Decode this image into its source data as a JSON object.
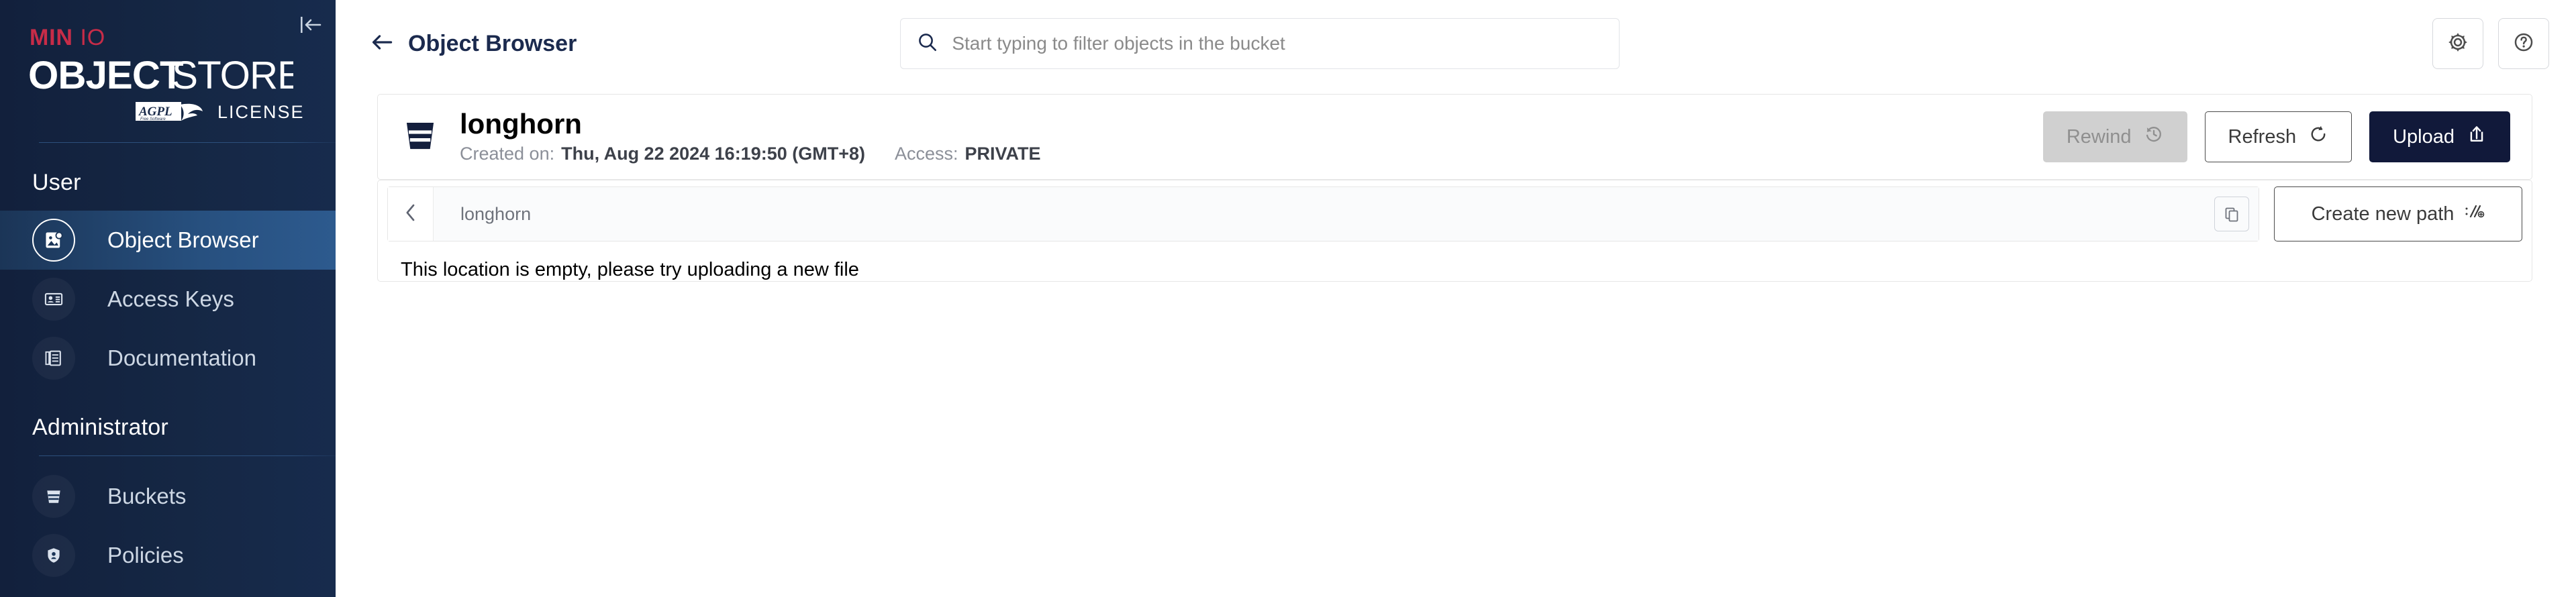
{
  "sidebar": {
    "logo": {
      "brand": "MINIO",
      "product_bold": "OBJECT",
      "product_light": "STORE",
      "license_badge": "AGPL",
      "license_badge_sub": "Free Software",
      "license_word": "LICENSE"
    },
    "collapse_icon": "collapse-sidebar-icon",
    "sections": [
      {
        "title": "User",
        "items": [
          {
            "label": "Object Browser",
            "icon": "object-browser-icon",
            "active": true
          },
          {
            "label": "Access Keys",
            "icon": "access-keys-icon",
            "active": false
          },
          {
            "label": "Documentation",
            "icon": "documentation-icon",
            "active": false
          }
        ]
      },
      {
        "title": "Administrator",
        "items": [
          {
            "label": "Buckets",
            "icon": "bucket-icon",
            "active": false
          },
          {
            "label": "Policies",
            "icon": "policies-shield-icon",
            "active": false
          }
        ]
      }
    ]
  },
  "topbar": {
    "back_icon": "arrow-left-icon",
    "title": "Object Browser",
    "search": {
      "icon": "search-icon",
      "placeholder": "Start typing to filter objects in the bucket",
      "value": ""
    },
    "settings_icon": "gear-icon",
    "help_icon": "help-circle-icon"
  },
  "bucket": {
    "icon": "bucket-icon",
    "name": "longhorn",
    "created_label": "Created on:",
    "created_value": "Thu, Aug 22 2024 16:19:50 (GMT+8)",
    "access_label": "Access:",
    "access_value": "PRIVATE",
    "actions": {
      "rewind": {
        "label": "Rewind",
        "icon": "rewind-clock-icon",
        "disabled": true
      },
      "refresh": {
        "label": "Refresh",
        "icon": "refresh-icon",
        "disabled": false
      },
      "upload": {
        "label": "Upload",
        "icon": "upload-icon",
        "disabled": false
      }
    }
  },
  "browser": {
    "back_icon": "chevron-left-icon",
    "breadcrumb": "longhorn",
    "copy_icon": "copy-icon",
    "create_path": {
      "label": "Create new path",
      "icon": "path-slash-icon"
    },
    "empty_message": "This location is empty, please try uploading a new file"
  },
  "colors": {
    "sidebar_dark": "#12203c",
    "sidebar_active": "#2d5a8e",
    "brand_red": "#c72c48",
    "primary_navy": "#11193a",
    "title_navy": "#1b2a4e",
    "muted_text": "#8b8f98",
    "border_light": "#e6e6e6",
    "disabled_grey": "#d0d0d0"
  }
}
